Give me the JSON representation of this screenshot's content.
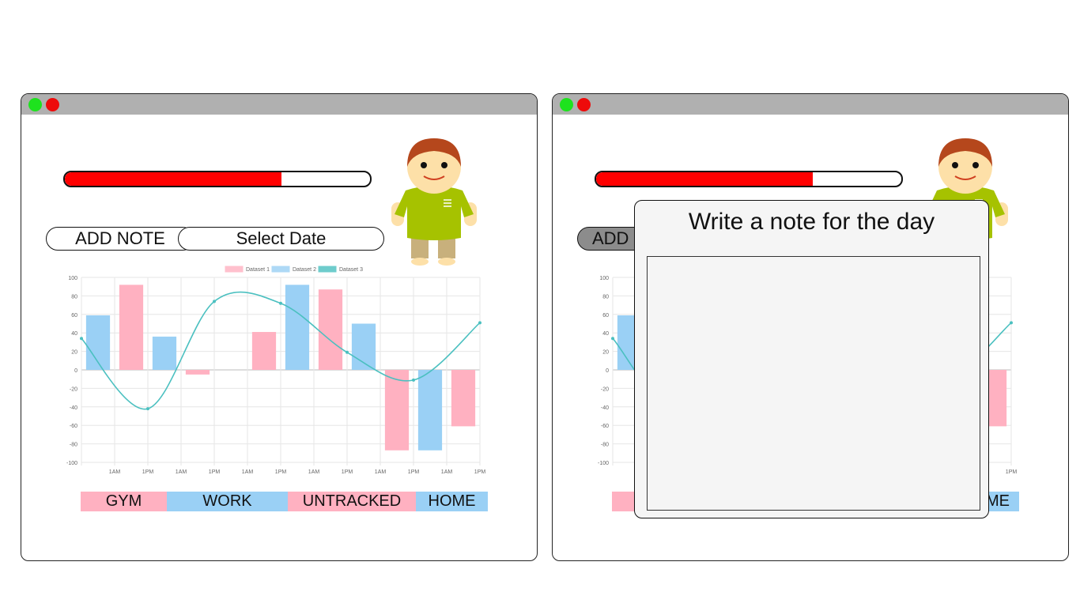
{
  "colors": {
    "progress_fill": "#ff0000",
    "dataset1": "#ffb1c1",
    "dataset2": "#9ad0f5",
    "dataset3": "#4bc0c0",
    "titlebar": "#b0b0b0",
    "close_dot": "#ee0b0b",
    "maximize_dot": "#1ee21e"
  },
  "left_window": {
    "progress": 0.71,
    "add_note_label": "ADD NOTE",
    "select_date_label": "Select Date",
    "avatar_icon": "character-avatar-icon",
    "categories": [
      {
        "label": "GYM",
        "color": "#ffb1c1"
      },
      {
        "label": "WORK",
        "color": "#9ad0f5"
      },
      {
        "label": "UNTRACKED",
        "color": "#ffb1c1"
      },
      {
        "label": "HOME",
        "color": "#9ad0f5"
      }
    ]
  },
  "right_window": {
    "progress": 0.71,
    "add_note_label": "ADD",
    "categories_visible": [
      "ME"
    ],
    "modal": {
      "title": "Write a note for the day",
      "textarea_value": ""
    }
  },
  "chart_data": {
    "type": "bar",
    "legend_position": "top",
    "grid": true,
    "ylim": [
      -100,
      100
    ],
    "y_ticks": [
      100,
      80,
      60,
      40,
      20,
      0,
      -20,
      -40,
      -60,
      -80,
      -100
    ],
    "categories": [
      "",
      "1AM",
      "1PM",
      "1AM",
      "1PM",
      "1AM",
      "1PM",
      "1AM",
      "1PM",
      "1AM",
      "1PM",
      "1AM",
      "1PM"
    ],
    "series": [
      {
        "name": "Dataset 1",
        "type": "bar",
        "values": [
          null,
          92,
          null,
          -5,
          null,
          41,
          null,
          87,
          null,
          -87,
          null,
          -61
        ]
      },
      {
        "name": "Dataset 2",
        "type": "bar",
        "values": [
          59,
          null,
          36,
          null,
          null,
          null,
          92,
          null,
          50,
          null,
          -87,
          null
        ]
      },
      {
        "name": "Dataset 3",
        "type": "line",
        "values": [
          34,
          null,
          -42,
          null,
          74,
          null,
          72,
          null,
          19,
          null,
          -11,
          null,
          51
        ]
      }
    ]
  }
}
